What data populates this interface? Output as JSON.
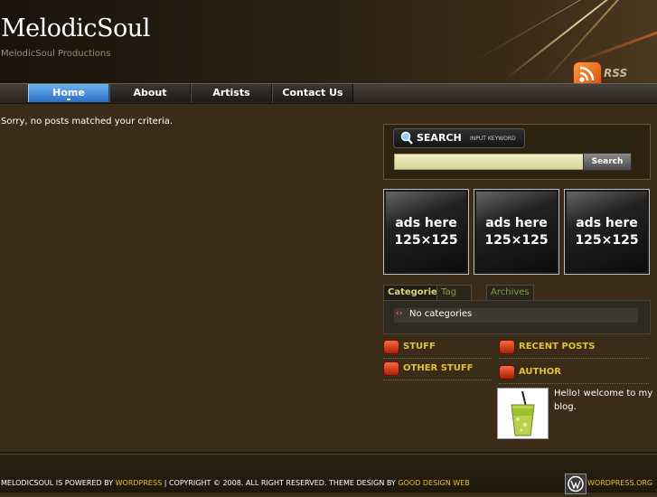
{
  "site": {
    "title": "MelodicSoul",
    "description": "MelodicSoul Productions",
    "rss_label": "RSS"
  },
  "nav": {
    "items": [
      {
        "label": "Home",
        "active": true
      },
      {
        "label": "About",
        "active": false
      },
      {
        "label": "Artists",
        "active": false
      },
      {
        "label": "Contact Us",
        "active": false
      }
    ]
  },
  "main": {
    "message": "Sorry, no posts matched your criteria."
  },
  "search": {
    "title": "SEARCH",
    "hint": "INPUT KEYWORD",
    "value": "",
    "button": "Search"
  },
  "ads": [
    {
      "line1": "ads here",
      "line2": "125×125"
    },
    {
      "line1": "ads here",
      "line2": "125×125"
    },
    {
      "line1": "ads here",
      "line2": "125×125"
    }
  ],
  "tabs": {
    "items": [
      {
        "label": "Categories",
        "active": true
      },
      {
        "label": "Tag Cloud",
        "active": false
      },
      {
        "label": "Archives",
        "active": false
      }
    ],
    "empty_text": "No categories"
  },
  "widgets": {
    "stuff": "STUFF",
    "other_stuff": "OTHER STUFF",
    "recent_posts": "RECENT POSTS",
    "author": "AUTHOR",
    "author_text": "Hello! welcome to my blog."
  },
  "footer": {
    "part1": "MELODICSOUL IS POWERED BY ",
    "wordpress_link": "WORDPRESS",
    "part2": " | COPYRIGHT © 2008. ALL RIGHT RESERVED. THEME DESIGN BY ",
    "designer_link": "GOOD DESIGN WEB",
    "wp_org": "WORDPRESS.ORG"
  },
  "colors": {
    "accent_yellow": "#e1c235",
    "nav_active_blue": "#2a6fc6",
    "background": "#3a2c18"
  }
}
